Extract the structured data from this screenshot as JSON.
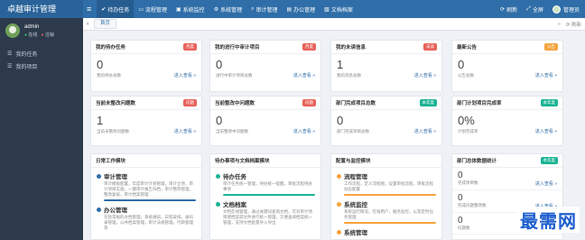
{
  "app": {
    "title": "卓越审计管理"
  },
  "topnav": [
    {
      "icon": "check-icon",
      "glyph": "✔",
      "label": "待办任务"
    },
    {
      "icon": "window-icon",
      "glyph": "▭",
      "label": "流程管理"
    },
    {
      "icon": "monitor-icon",
      "glyph": "▣",
      "label": "系统监控"
    },
    {
      "icon": "gear-icon",
      "glyph": "⚙",
      "label": "系统管理"
    },
    {
      "icon": "search-icon",
      "glyph": "⌕",
      "label": "审计管理"
    },
    {
      "icon": "office-icon",
      "glyph": "▤",
      "label": "办公管理"
    },
    {
      "icon": "document-icon",
      "glyph": "▧",
      "label": "文档档案"
    }
  ],
  "topright": {
    "refresh": "刷新",
    "fullscreen": "全屏",
    "user": "管理员"
  },
  "sidebar": {
    "user": {
      "name": "admin",
      "online": "在线",
      "logout": "注销"
    },
    "items": [
      {
        "icon": "list-icon",
        "glyph": "☰",
        "label": "我的任务"
      },
      {
        "icon": "list-icon",
        "glyph": "☰",
        "label": "我的项目"
      }
    ]
  },
  "tabs": {
    "home": "首页",
    "refresh": "⟳ 刷新"
  },
  "stat_cards": [
    {
      "title": "我的待办任务",
      "badge": "月度",
      "value": "0",
      "note": "我的待办总数",
      "link": "进入查看 »"
    },
    {
      "title": "我的进行中审计项目",
      "badge": "月度",
      "value": "0",
      "note": "进行中审计项目总数",
      "link": "进入查看 »"
    },
    {
      "title": "我的未读信息",
      "badge": "未读",
      "value": "1",
      "note": "我的消息总数",
      "link": "进入查看 »"
    },
    {
      "title": "最新公告",
      "badge": "公告",
      "value": "0",
      "note": "公告总数",
      "link": "进入查看 »"
    },
    {
      "title": "当前未整改问题数",
      "badge": "问题",
      "value": "1",
      "note": "当前未整改问题数",
      "link": "进入查看 »"
    },
    {
      "title": "当前整改中问题数",
      "badge": "问题",
      "value": "0",
      "note": "当前整改中问题数",
      "link": "进入查看 »"
    },
    {
      "title": "部门完成项目总数",
      "badge": "本年度",
      "value": "0",
      "note": "部门完成项目总数",
      "link": "进入查看 »"
    },
    {
      "title": "部门计划项目完成率",
      "badge": "本年度",
      "value": "0%",
      "note": "计划完成率",
      "link": "进入查看 »"
    }
  ],
  "panels": {
    "daily": {
      "title": "日常工作模块",
      "sections": [
        {
          "title": "审计管理",
          "desc": "审计模板配置，年度审计计划管理，审计立项，审计项目实施，一键审计报告归档，审计整改管理，整改复核，审计档案管理"
        },
        {
          "title": "办公管理",
          "desc": "包括常规的文档管理，系统通知，日程安排，通讯录管理，公共档案管理，审计法规管理，行政管理等"
        }
      ]
    },
    "todo": {
      "title": "待办事项与文档档案模块",
      "sections": [
        {
          "title": "待办任务",
          "desc": "审计任务统一管理，待办统一提醒，审批流程待办事项"
        },
        {
          "title": "文档档案",
          "desc": "文档在线管理，通过关键词查询文档，可对审计项目建档案袋文件进行统一管理，方便查阅档案统一管理，支持文档批量导入导出"
        }
      ]
    },
    "config": {
      "title": "配置与监控模块",
      "sections": [
        {
          "title": "流程管理",
          "desc": "工作流程，定义流程图，设置审批流程，审批流程动态配置"
        },
        {
          "title": "系统监控",
          "desc": "系统运行情况，在线用户，服务监控，以及定时任务管理"
        },
        {
          "title": "系统管理",
          "desc": ""
        }
      ]
    },
    "dept": {
      "title": "部门总体数据统计",
      "badge": "本年度",
      "rows": [
        {
          "value": "0",
          "note": "完成项目数",
          "link": "进入查看 »"
        },
        {
          "value": "0",
          "note": "完成问题整改数",
          "link": "进入查看 »"
        },
        {
          "value": "0",
          "note": "问题数",
          "link": ""
        }
      ]
    }
  },
  "watermark": "最需网",
  "colors": {
    "topbar": "#2f6ea8",
    "sidebar": "#2d3a4b",
    "red_badge": "#e8625a",
    "orange_badge": "#f6a33d",
    "teal_badge": "#1cb394"
  }
}
